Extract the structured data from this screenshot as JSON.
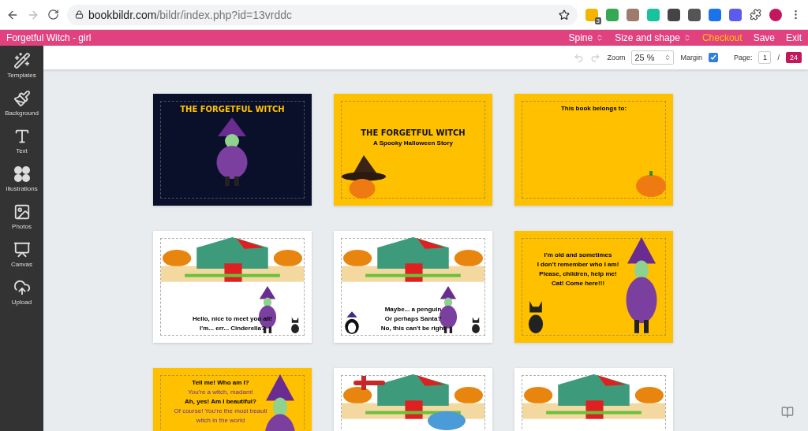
{
  "browser": {
    "url_host": "bookbildr.com",
    "url_path": "/bildr/index.php?id=13vrddc",
    "extension_badge": "3"
  },
  "header": {
    "title": "Forgetful Witch - girl",
    "menu": [
      {
        "label": "Spine",
        "kind": "dropdown"
      },
      {
        "label": "Size and shape",
        "kind": "dropdown"
      },
      {
        "label": "Checkout",
        "kind": "highlight"
      },
      {
        "label": "Save",
        "kind": "plain"
      },
      {
        "label": "Exit",
        "kind": "plain"
      }
    ]
  },
  "sidebar": {
    "items": [
      {
        "label": "Templates",
        "kind": "templates"
      },
      {
        "label": "Background",
        "kind": "background"
      },
      {
        "label": "Text",
        "kind": "text"
      },
      {
        "label": "Illustrations",
        "kind": "illustrations"
      },
      {
        "label": "Photos",
        "kind": "photos"
      },
      {
        "label": "Canvas",
        "kind": "canvas"
      },
      {
        "label": "Upload",
        "kind": "upload"
      }
    ]
  },
  "toolbar": {
    "undo_disabled": true,
    "redo_disabled": true,
    "zoom_label": "Zoom",
    "zoom_value": "25 %",
    "margin_label": "Margin",
    "margin_checked": true,
    "page_label": "Page:",
    "page_value": "1",
    "page_separator": "/",
    "page_total": "24"
  },
  "pages": [
    {
      "kind": "night",
      "title": "THE FORGETFUL WITCH",
      "illustrations": [
        {
          "kind": "witch"
        }
      ]
    },
    {
      "kind": "yellow",
      "title": "THE FORGETFUL WITCH",
      "illustrations": [
        {
          "kind": "hat-pumpkin"
        }
      ],
      "lines": [
        {
          "text": "A Spooky Halloween Story",
          "kind": "speech"
        }
      ]
    },
    {
      "kind": "yellow",
      "illustrations": [
        {
          "kind": "pumpkin"
        }
      ],
      "lines": [
        {
          "text": "This book belongs to:",
          "kind": "speech"
        }
      ]
    },
    {
      "kind": "white",
      "illustrations": [
        {
          "kind": "house"
        },
        {
          "kind": "witch"
        },
        {
          "kind": "cat"
        }
      ],
      "lines": [
        {
          "text": "Hello, nice to meet you all!",
          "kind": "speech"
        },
        {
          "text": "I'm... err... Cinderella?",
          "kind": "speech"
        }
      ]
    },
    {
      "kind": "white",
      "illustrations": [
        {
          "kind": "house"
        },
        {
          "kind": "penguin"
        },
        {
          "kind": "witch"
        },
        {
          "kind": "cat"
        }
      ],
      "lines": [
        {
          "text": "Maybe... a penguin",
          "kind": "speech"
        },
        {
          "text": "Or perhaps Santa?",
          "kind": "speech"
        },
        {
          "text": "No, this can't be right",
          "kind": "speech"
        }
      ]
    },
    {
      "kind": "yellow",
      "illustrations": [
        {
          "kind": "witch"
        },
        {
          "kind": "cat"
        }
      ],
      "lines": [
        {
          "text": "I'm old and sometimes",
          "kind": "speech"
        },
        {
          "text": "I don't remember who I am!",
          "kind": "speech"
        },
        {
          "text": "Please, children, help me!",
          "kind": "speech"
        },
        {
          "text": "Cat! Come here!!!",
          "kind": "speech"
        }
      ]
    },
    {
      "kind": "yellow",
      "illustrations": [
        {
          "kind": "witch"
        }
      ],
      "lines": [
        {
          "text": "Tell me! Who am I?",
          "kind": "speech"
        },
        {
          "text": "You're a witch, madam!",
          "kind": "reply"
        },
        {
          "text": "Ah, yes! Am I beautiful?",
          "kind": "speech"
        },
        {
          "text": "Of course! You're the most beauti",
          "kind": "reply"
        },
        {
          "text": "witch in the world",
          "kind": "reply"
        }
      ]
    },
    {
      "kind": "white",
      "illustrations": [
        {
          "kind": "house"
        },
        {
          "kind": "plane"
        },
        {
          "kind": "cloud"
        }
      ]
    },
    {
      "kind": "white",
      "illustrations": [
        {
          "kind": "house"
        }
      ]
    }
  ]
}
